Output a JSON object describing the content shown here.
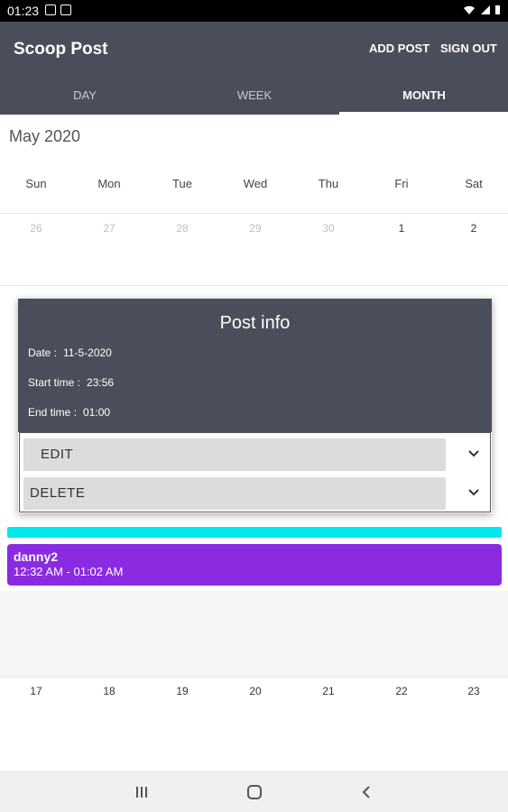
{
  "status_bar": {
    "time": "01:23"
  },
  "app_bar": {
    "title": "Scoop Post",
    "actions": {
      "add_post": "ADD POST",
      "sign_out": "SIGN OUT"
    },
    "tabs": [
      {
        "label": "DAY",
        "selected": false
      },
      {
        "label": "WEEK",
        "selected": false
      },
      {
        "label": "MONTH",
        "selected": true
      }
    ]
  },
  "calendar": {
    "month_title": "May 2020",
    "weekdays": [
      "Sun",
      "Mon",
      "Tue",
      "Wed",
      "Thu",
      "Fri",
      "Sat"
    ],
    "first_week": [
      "26",
      "27",
      "28",
      "29",
      "30",
      "1",
      "2"
    ],
    "later_week": [
      "17",
      "18",
      "19",
      "20",
      "21",
      "22",
      "23"
    ],
    "events": [
      {
        "title": "danny2",
        "time": "12:32 AM - 01:02 AM",
        "color": "#8a2be2"
      }
    ],
    "cyan_event_color": "#00e8f0"
  },
  "dialog": {
    "title": "Post info",
    "date_label": "Date :",
    "date_value": "11-5-2020",
    "start_label": "Start time :",
    "start_value": "23:56",
    "end_label": "End time :",
    "end_value": "01:00",
    "options": {
      "edit": "EDIT",
      "delete": "DELETE"
    }
  },
  "colors": {
    "primary": "#4a4e5a",
    "event_purple": "#8a2be2",
    "event_cyan": "#00e8f0"
  }
}
